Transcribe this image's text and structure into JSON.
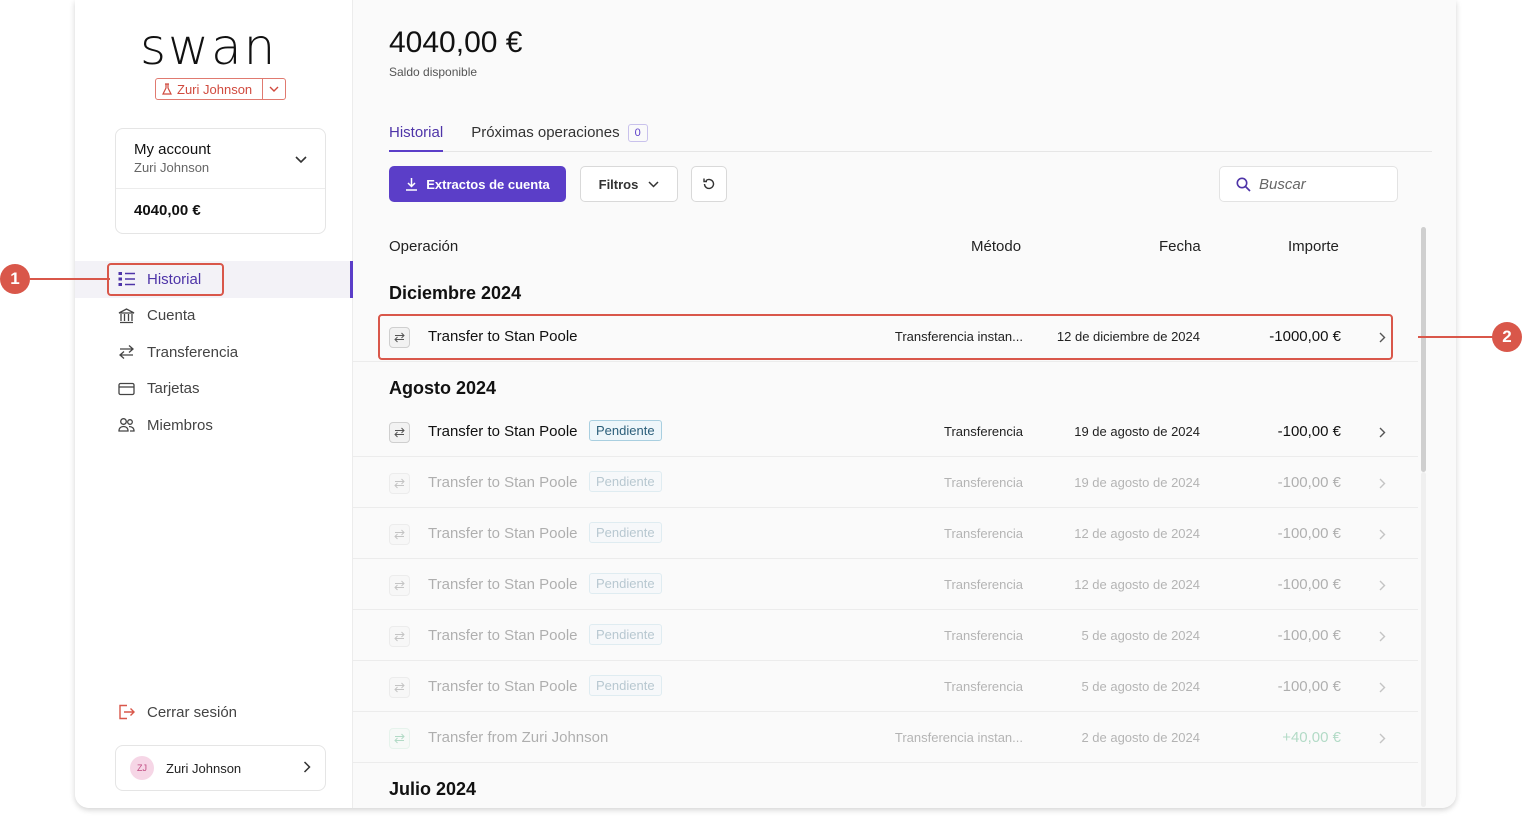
{
  "brand": {
    "logo_text": "swan"
  },
  "user_chip": {
    "name": "Zuri Johnson"
  },
  "account": {
    "title": "My account",
    "holder": "Zuri Johnson",
    "balance": "4040,00 €"
  },
  "nav": {
    "items": [
      {
        "id": "historial",
        "label": "Historial",
        "icon": "list-icon",
        "active": true
      },
      {
        "id": "cuenta",
        "label": "Cuenta",
        "icon": "bank-icon",
        "active": false
      },
      {
        "id": "transferencia",
        "label": "Transferencia",
        "icon": "transfer-icon",
        "active": false
      },
      {
        "id": "tarjetas",
        "label": "Tarjetas",
        "icon": "card-icon",
        "active": false
      },
      {
        "id": "miembros",
        "label": "Miembros",
        "icon": "members-icon",
        "active": false
      }
    ],
    "logout_label": "Cerrar sesión"
  },
  "footer_user": {
    "initials": "ZJ",
    "name": "Zuri Johnson"
  },
  "header": {
    "balance": "4040,00 €",
    "balance_label": "Saldo disponible"
  },
  "tabs": [
    {
      "label": "Historial",
      "active": true
    },
    {
      "label": "Próximas operaciones",
      "badge": "0",
      "active": false
    }
  ],
  "toolbar": {
    "statements_label": "Extractos de cuenta",
    "filters_label": "Filtros",
    "search_placeholder": "Buscar"
  },
  "table": {
    "columns": {
      "operation": "Operación",
      "method": "Método",
      "date": "Fecha",
      "amount": "Importe"
    },
    "groups": [
      {
        "title": "Diciembre 2024",
        "rows": [
          {
            "label": "Transfer to Stan Poole",
            "badge": "",
            "method": "Transferencia instan...",
            "date": "12 de diciembre de 2024",
            "amount": "-1000,00 €",
            "faded": false,
            "positive": false
          }
        ]
      },
      {
        "title": "Agosto 2024",
        "rows": [
          {
            "label": "Transfer to Stan Poole",
            "badge": "Pendiente",
            "method": "Transferencia",
            "date": "19 de agosto de 2024",
            "amount": "-100,00 €",
            "faded": false,
            "positive": false
          },
          {
            "label": "Transfer to Stan Poole",
            "badge": "Pendiente",
            "method": "Transferencia",
            "date": "19 de agosto de 2024",
            "amount": "-100,00 €",
            "faded": true,
            "positive": false
          },
          {
            "label": "Transfer to Stan Poole",
            "badge": "Pendiente",
            "method": "Transferencia",
            "date": "12 de agosto de 2024",
            "amount": "-100,00 €",
            "faded": true,
            "positive": false
          },
          {
            "label": "Transfer to Stan Poole",
            "badge": "Pendiente",
            "method": "Transferencia",
            "date": "12 de agosto de 2024",
            "amount": "-100,00 €",
            "faded": true,
            "positive": false
          },
          {
            "label": "Transfer to Stan Poole",
            "badge": "Pendiente",
            "method": "Transferencia",
            "date": "5 de agosto de 2024",
            "amount": "-100,00 €",
            "faded": true,
            "positive": false
          },
          {
            "label": "Transfer to Stan Poole",
            "badge": "Pendiente",
            "method": "Transferencia",
            "date": "5 de agosto de 2024",
            "amount": "-100,00 €",
            "faded": true,
            "positive": false
          },
          {
            "label": "Transfer from Zuri Johnson",
            "badge": "",
            "method": "Transferencia instan...",
            "date": "2 de agosto de 2024",
            "amount": "+40,00 €",
            "faded": true,
            "positive": true
          }
        ]
      },
      {
        "title": "Julio 2024",
        "rows": []
      }
    ]
  },
  "annotations": {
    "callout_1": "1",
    "callout_2": "2"
  },
  "colors": {
    "accent": "#5b3ec8",
    "highlight": "#d9574a",
    "positive": "#1d9a5b",
    "pending_badge": "#2c5f7a"
  }
}
